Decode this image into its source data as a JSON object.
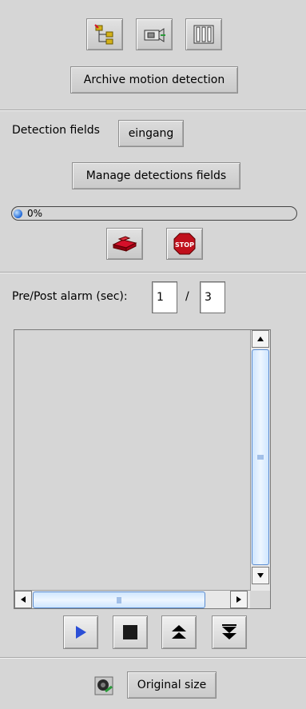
{
  "toolbar": {
    "icons": [
      "hierarchy-tree-icon",
      "camera-export-icon",
      "film-strip-icon"
    ],
    "archive_button": "Archive motion detection"
  },
  "detection": {
    "fields_label": "Detection fields",
    "field_value": "eingang",
    "manage_button": "Manage detections fields",
    "progress_text": "0%",
    "progress_value": 0
  },
  "alarm": {
    "label": "Pre/Post alarm (sec):",
    "pre_value": "1",
    "separator": "/",
    "post_value": "3"
  },
  "playback": {
    "buttons": [
      "play-icon",
      "stop-icon",
      "step-up-icon",
      "step-down-icon"
    ]
  },
  "footer": {
    "original_size_button": "Original size"
  },
  "colors": {
    "background": "#d6d6d6",
    "accent_blue": "#2b4fd6",
    "record_red": "#d4102a",
    "scroll_thumb": "#cfe6ff"
  }
}
